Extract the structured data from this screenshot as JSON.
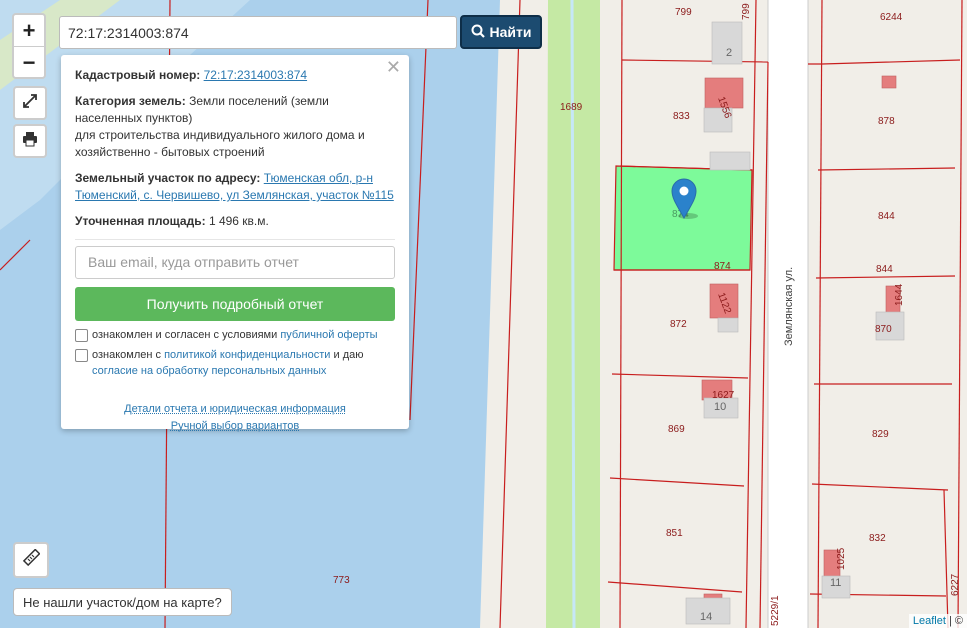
{
  "search": {
    "value": "72:17:2314003:874",
    "button_label": "Найти"
  },
  "controls": {
    "zoom_in": "+",
    "zoom_out": "−"
  },
  "popup": {
    "cadastral_label": "Кадастровый номер:",
    "cadastral_number": "72:17:2314003:874",
    "category_label": "Категория земель:",
    "category_line1": "Земли поселений (земли",
    "category_line2": "населенных пунктов)",
    "category_line3": "для строительства индивидуального жилого дома и",
    "category_line4": "хозяйственно - бытовых строений",
    "address_label": "Земельный участок по адресу:",
    "address_line1": "Тюменская обл, р-н",
    "address_line2": "Тюменский, с. Червишево, ул Землянская, участок №115",
    "area_label": "Уточненная площадь:",
    "area_value": "1 496 кв.м.",
    "email_placeholder": "Ваш email, куда отправить отчет",
    "report_button": "Получить подробный отчет",
    "check1_text": "ознакомлен и согласен с условиями",
    "check1_link": "публичной оферты",
    "check2_text": "ознакомлен с",
    "check2_link": "политикой конфиденциальности",
    "check2_and": "и даю",
    "check2_link2": "согласие на обработку персональных данных",
    "details_link": "Детали отчета и юридическая информация",
    "manual_link": "Ручной выбор вариантов"
  },
  "not_found": "Не нашли участок/дом на карте?",
  "attribution": {
    "leaflet": "Leaflet",
    "sep": "| ©"
  },
  "map": {
    "street": "Землянская ул.",
    "parcels": [
      "799",
      "6244",
      "833",
      "878",
      "844",
      "874",
      "872",
      "870",
      "869",
      "829",
      "851",
      "832",
      "773",
      "1689",
      "6227",
      "5229/1"
    ],
    "selected_parcel": "874",
    "selected_label": "874",
    "buildings": [
      "2",
      "1556",
      "1122",
      "1627",
      "10",
      "1644",
      "1025",
      "11",
      "14"
    ],
    "colors": {
      "selected": "#7dfa9a",
      "boundary": "#c81e1e",
      "water": "#abd0ec",
      "greenery": "#c5e9a4"
    }
  }
}
